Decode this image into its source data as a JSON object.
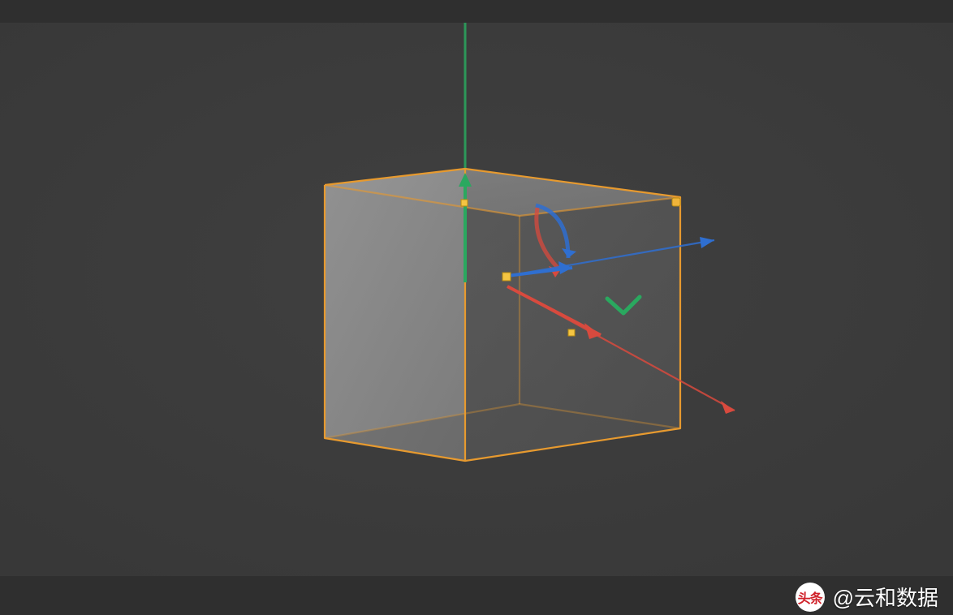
{
  "watermark": {
    "logo_text": "头条",
    "text": "@云和数据"
  },
  "scene": {
    "object": "Cube",
    "selected": true,
    "selection_color": "#e79a2f",
    "axes": {
      "x_color": "#d84a3e",
      "y_color": "#2aa85f",
      "z_color": "#2f6fd1"
    },
    "gizmo_handles": [
      "x-arrow",
      "y-arrow",
      "z-arrow",
      "x-rotate",
      "y-rotate",
      "z-rotate",
      "xy-plane",
      "yz-plane",
      "xz-plane"
    ]
  }
}
